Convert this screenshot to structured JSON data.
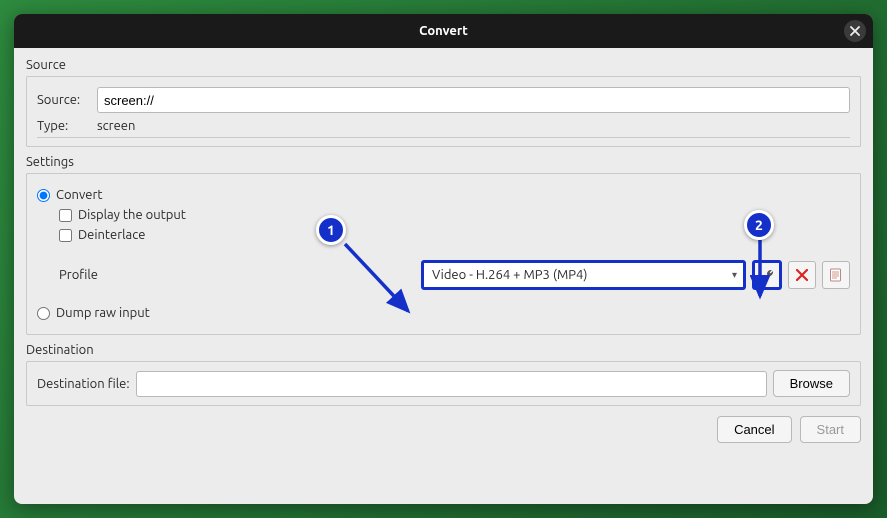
{
  "titlebar": {
    "title": "Convert"
  },
  "source": {
    "section_label": "Source",
    "source_label": "Source:",
    "source_value": "screen://",
    "type_label": "Type:",
    "type_value": "screen"
  },
  "settings": {
    "section_label": "Settings",
    "convert_label": "Convert",
    "display_output_label": "Display the output",
    "deinterlace_label": "Deinterlace",
    "profile_label": "Profile",
    "profile_value": "Video - H.264 + MP3 (MP4)",
    "dump_raw_label": "Dump raw input"
  },
  "destination": {
    "section_label": "Destination",
    "file_label": "Destination file:",
    "file_value": "",
    "browse_label": "Browse"
  },
  "footer": {
    "cancel_label": "Cancel",
    "start_label": "Start"
  },
  "annotations": {
    "badge1": "1",
    "badge2": "2"
  },
  "icons": {
    "close": "close-icon",
    "wrench": "wrench-icon",
    "delete": "delete-icon",
    "new": "new-profile-icon",
    "dropdown": "chevron-down-icon"
  }
}
